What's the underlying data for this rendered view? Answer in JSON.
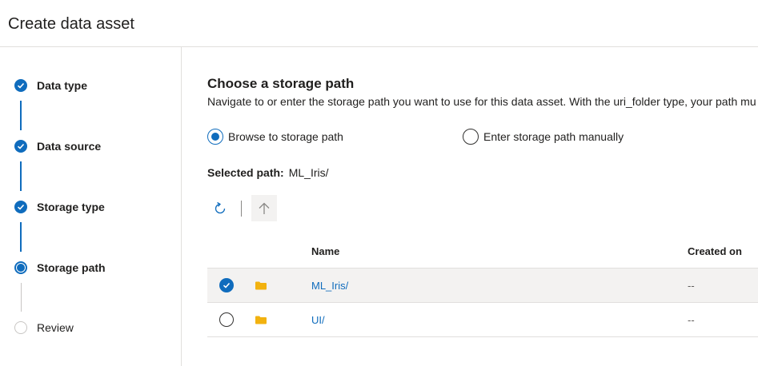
{
  "header": {
    "title": "Create data asset"
  },
  "steps": [
    {
      "label": "Data type",
      "state": "done"
    },
    {
      "label": "Data source",
      "state": "done"
    },
    {
      "label": "Storage type",
      "state": "done"
    },
    {
      "label": "Storage path",
      "state": "current"
    },
    {
      "label": "Review",
      "state": "pending"
    }
  ],
  "main": {
    "title": "Choose a storage path",
    "description": "Navigate to or enter the storage path you want to use for this data asset. With the uri_folder type, your path mu",
    "options": [
      {
        "label": "Browse to storage path",
        "checked": true
      },
      {
        "label": "Enter storage path manually",
        "checked": false
      }
    ],
    "selected_path_label": "Selected path:",
    "selected_path_value": "ML_Iris/",
    "toolbar": {
      "refresh_icon": "refresh-icon",
      "up_icon": "arrow-up-icon"
    },
    "table": {
      "columns": [
        "Name",
        "Created on"
      ],
      "rows": [
        {
          "name": "ML_Iris/",
          "created_on": "--",
          "selected": true,
          "icon": "folder-icon"
        },
        {
          "name": "UI/",
          "created_on": "--",
          "selected": false,
          "icon": "folder-icon"
        }
      ]
    }
  },
  "colors": {
    "accent": "#0f6cbd",
    "folder": "#f2b20f",
    "border": "#e1dfdd"
  }
}
